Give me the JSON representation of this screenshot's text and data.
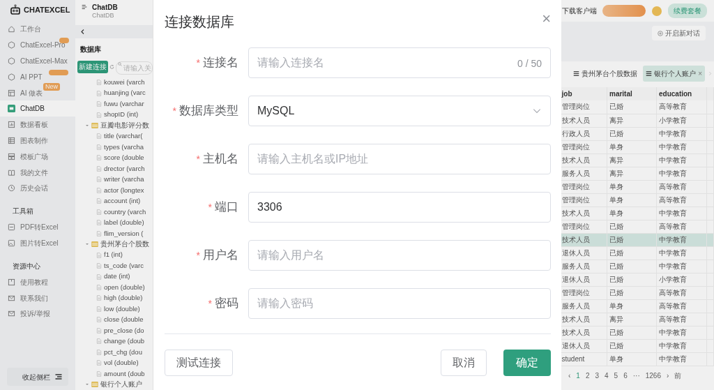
{
  "sidebar": {
    "logo": "CHATEXCEL",
    "items": [
      {
        "label": "工作台",
        "selected": false
      },
      {
        "label": "ChatExcel-Pro",
        "selected": false,
        "promo_tag": true
      },
      {
        "label": "ChatExcel-Max",
        "selected": false
      },
      {
        "label": "AI PPT",
        "selected": false,
        "promo_tag": true
      },
      {
        "label": "AI 做表",
        "selected": false,
        "badge": "New"
      },
      {
        "label": "ChatDB",
        "selected": true
      },
      {
        "label": "数据看板",
        "selected": false
      },
      {
        "label": "图表制作",
        "selected": false
      },
      {
        "label": "模板广场",
        "selected": false
      },
      {
        "label": "我的文件",
        "selected": false
      },
      {
        "label": "历史会话",
        "selected": false
      }
    ],
    "sections": [
      {
        "title": "工具箱",
        "items": [
          {
            "label": "PDF转Excel",
            "selected": false
          },
          {
            "label": "图片转Excel",
            "selected": false
          }
        ]
      },
      {
        "title": "资源中心",
        "items": [
          {
            "label": "使用教程",
            "selected": false
          },
          {
            "label": "联系我们",
            "selected": false
          },
          {
            "label": "投诉/举报",
            "selected": false
          }
        ]
      }
    ],
    "collapse_label": "收起侧栏"
  },
  "db_panel": {
    "title": "ChatDB",
    "subtitle": "ChatDB",
    "heading": "数据库",
    "new_button": "新建连接",
    "search_placeholder": "请输入关",
    "tree": [
      {
        "kind": "field",
        "label": "kouwei (varch"
      },
      {
        "kind": "field",
        "label": "huanjing (varc"
      },
      {
        "kind": "field",
        "label": "fuwu (varchar"
      },
      {
        "kind": "field",
        "label": "shopID (int)"
      },
      {
        "kind": "table",
        "label": "豆瓣电影评分数",
        "expanded": true,
        "children": [
          {
            "kind": "field",
            "label": "title (varchar("
          },
          {
            "kind": "field",
            "label": "types (varcha"
          },
          {
            "kind": "field",
            "label": "score (double"
          },
          {
            "kind": "field",
            "label": "drector (varch"
          },
          {
            "kind": "field",
            "label": "writer (varcha"
          },
          {
            "kind": "field",
            "label": "actor (longtex"
          },
          {
            "kind": "field",
            "label": "account (int)"
          },
          {
            "kind": "field",
            "label": "country (varch"
          },
          {
            "kind": "field",
            "label": "label (double)"
          },
          {
            "kind": "field",
            "label": "flim_version ("
          }
        ]
      },
      {
        "kind": "table",
        "label": "贵州茅台个股数",
        "expanded": true,
        "children": [
          {
            "kind": "field",
            "label": "f1 (int)"
          },
          {
            "kind": "field",
            "label": "ts_code (varc"
          },
          {
            "kind": "field",
            "label": "date (int)"
          },
          {
            "kind": "field",
            "label": "open (double)"
          },
          {
            "kind": "field",
            "label": "high (double)"
          },
          {
            "kind": "field",
            "label": "low (double)"
          },
          {
            "kind": "field",
            "label": "close (double"
          },
          {
            "kind": "field",
            "label": "pre_close (do"
          },
          {
            "kind": "field",
            "label": "change (doub"
          },
          {
            "kind": "field",
            "label": "pct_chg (dou"
          },
          {
            "kind": "field",
            "label": "vol (double)"
          },
          {
            "kind": "field",
            "label": "amount (doub"
          }
        ]
      },
      {
        "kind": "table",
        "label": "银行个人账户",
        "expanded": true
      }
    ]
  },
  "top_bar": {
    "download": "下载客户端",
    "renew": "续费套餐",
    "new_chat": "开启新对话"
  },
  "tabs": [
    {
      "label": "贵州茅台个股数据",
      "selected": false
    },
    {
      "label": "银行个人账户",
      "selected": true,
      "close": "×"
    }
  ],
  "table": {
    "columns": [
      "job",
      "marital",
      "education"
    ],
    "rows": [
      {
        "cells": [
          "管理岗位",
          "已婚",
          "高等教育"
        ],
        "selected": false
      },
      {
        "cells": [
          "技术人员",
          "离异",
          "小学教育"
        ],
        "selected": false
      },
      {
        "cells": [
          "行政人员",
          "已婚",
          "中学教育"
        ],
        "selected": false
      },
      {
        "cells": [
          "管理岗位",
          "单身",
          "中学教育"
        ],
        "selected": false
      },
      {
        "cells": [
          "技术人员",
          "离异",
          "中学教育"
        ],
        "selected": false
      },
      {
        "cells": [
          "服务人员",
          "离异",
          "中学教育"
        ],
        "selected": false
      },
      {
        "cells": [
          "管理岗位",
          "单身",
          "高等教育"
        ],
        "selected": false
      },
      {
        "cells": [
          "管理岗位",
          "单身",
          "高等教育"
        ],
        "selected": false
      },
      {
        "cells": [
          "技术人员",
          "单身",
          "中学教育"
        ],
        "selected": false
      },
      {
        "cells": [
          "管理岗位",
          "已婚",
          "高等教育"
        ],
        "selected": false
      },
      {
        "cells": [
          "技术人员",
          "已婚",
          "中学教育"
        ],
        "selected": true
      },
      {
        "cells": [
          "退休人员",
          "已婚",
          "中学教育"
        ],
        "selected": false
      },
      {
        "cells": [
          "服务人员",
          "已婚",
          "中学教育"
        ],
        "selected": false
      },
      {
        "cells": [
          "退休人员",
          "已婚",
          "小学教育"
        ],
        "selected": false
      },
      {
        "cells": [
          "管理岗位",
          "已婚",
          "高等教育"
        ],
        "selected": false
      },
      {
        "cells": [
          "服务人员",
          "单身",
          "高等教育"
        ],
        "selected": false
      },
      {
        "cells": [
          "技术人员",
          "离异",
          "高等教育"
        ],
        "selected": false
      },
      {
        "cells": [
          "技术人员",
          "已婚",
          "中学教育"
        ],
        "selected": false
      },
      {
        "cells": [
          "退休人员",
          "已婚",
          "中学教育"
        ],
        "selected": false
      },
      {
        "cells": [
          "student",
          "单身",
          "中学教育"
        ],
        "selected": false
      }
    ]
  },
  "pagination": {
    "prev": "‹",
    "pages": [
      {
        "label": "1",
        "selected": true
      },
      {
        "label": "2",
        "selected": false
      },
      {
        "label": "3",
        "selected": false
      },
      {
        "label": "4",
        "selected": false
      },
      {
        "label": "5",
        "selected": false
      },
      {
        "label": "6",
        "selected": false
      },
      {
        "label": "···",
        "selected": false
      },
      {
        "label": "1266",
        "selected": false
      }
    ],
    "next": "›",
    "goto": "前"
  },
  "dialog": {
    "title": "连接数据库",
    "close": "×",
    "fields": [
      {
        "kind": "text",
        "mark": "*",
        "label": "连接名",
        "placeholder": "请输入连接名",
        "counter": "0 / 50"
      },
      {
        "kind": "select",
        "mark": "*",
        "label": "数据库类型",
        "value": "MySQL"
      },
      {
        "kind": "text",
        "mark": "*",
        "label": "主机名",
        "placeholder": "请输入主机名或IP地址"
      },
      {
        "kind": "text",
        "mark": "*",
        "label": "端口",
        "value": "3306"
      },
      {
        "kind": "text",
        "mark": "*",
        "label": "用户名",
        "placeholder": "请输入用户名"
      },
      {
        "kind": "password",
        "mark": "*",
        "label": "密码",
        "placeholder": "请输入密码"
      }
    ],
    "test_button": "测试连接",
    "cancel_button": "取消",
    "ok_button": "确定"
  }
}
